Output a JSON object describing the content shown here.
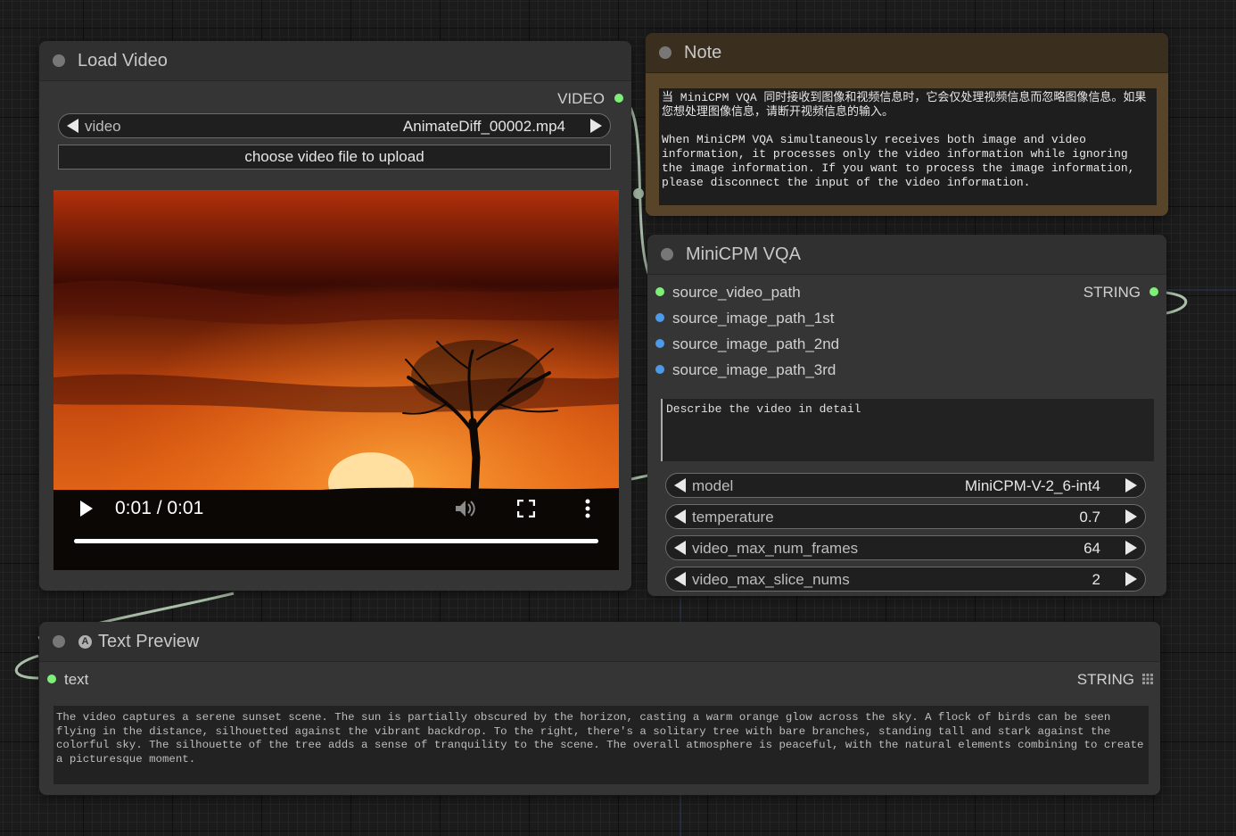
{
  "load_video": {
    "title": "Load Video",
    "output_label": "VIDEO",
    "video_widget": {
      "label": "video",
      "value": "AnimateDiff_00002.mp4"
    },
    "upload_button": "choose video file to upload",
    "player": {
      "time": "0:01 / 0:01",
      "progress": 1.0
    }
  },
  "note": {
    "title": "Note",
    "text_zh": "当 MiniCPM VQA 同时接收到图像和视频信息时，它会仅处理视频信息而忽略图像信息。如果您想处理图像信息，请断开视频信息的输入。",
    "text_en": "When MiniCPM VQA simultaneously receives both image and video information, it processes only the video information while ignoring the image information. If you want to process the image information, please disconnect the input of the video information."
  },
  "vqa": {
    "title": "MiniCPM VQA",
    "inputs": [
      "source_video_path",
      "source_image_path_1st",
      "source_image_path_2nd",
      "source_image_path_3rd"
    ],
    "output_label": "STRING",
    "prompt": "Describe the video in detail",
    "widgets": [
      {
        "label": "model",
        "value": "MiniCPM-V-2_6-int4"
      },
      {
        "label": "temperature",
        "value": "0.7"
      },
      {
        "label": "video_max_num_frames",
        "value": "64"
      },
      {
        "label": "video_max_slice_nums",
        "value": "2"
      }
    ]
  },
  "text_preview": {
    "title": "Text Preview",
    "input_label": "text",
    "output_label": "STRING",
    "content": "The video captures a serene sunset scene. The sun is partially obscured by the horizon, casting a warm orange glow across the sky. A flock of birds can be seen flying in the distance, silhouetted against the vibrant backdrop. To the right, there's a solitary tree with bare branches, standing tall and stark against the colorful sky. The silhouette of the tree adds a sense of tranquility to the scene. The overall atmosphere is peaceful, with the natural elements combining to create a picturesque moment."
  },
  "colors": {
    "canvas": "#1b1b1b",
    "node_body": "#353535",
    "node_title": "#303030",
    "note_body": "#584428",
    "note_title": "#3a2e1e",
    "slot_green": "#7ef07a",
    "slot_blue": "#4d9ae8",
    "wire": "#a9bfa8"
  },
  "icons": [
    "play-icon",
    "volume-icon",
    "fullscreen-icon",
    "more-vert-icon",
    "grid-icon",
    "badge-a-icon"
  ]
}
